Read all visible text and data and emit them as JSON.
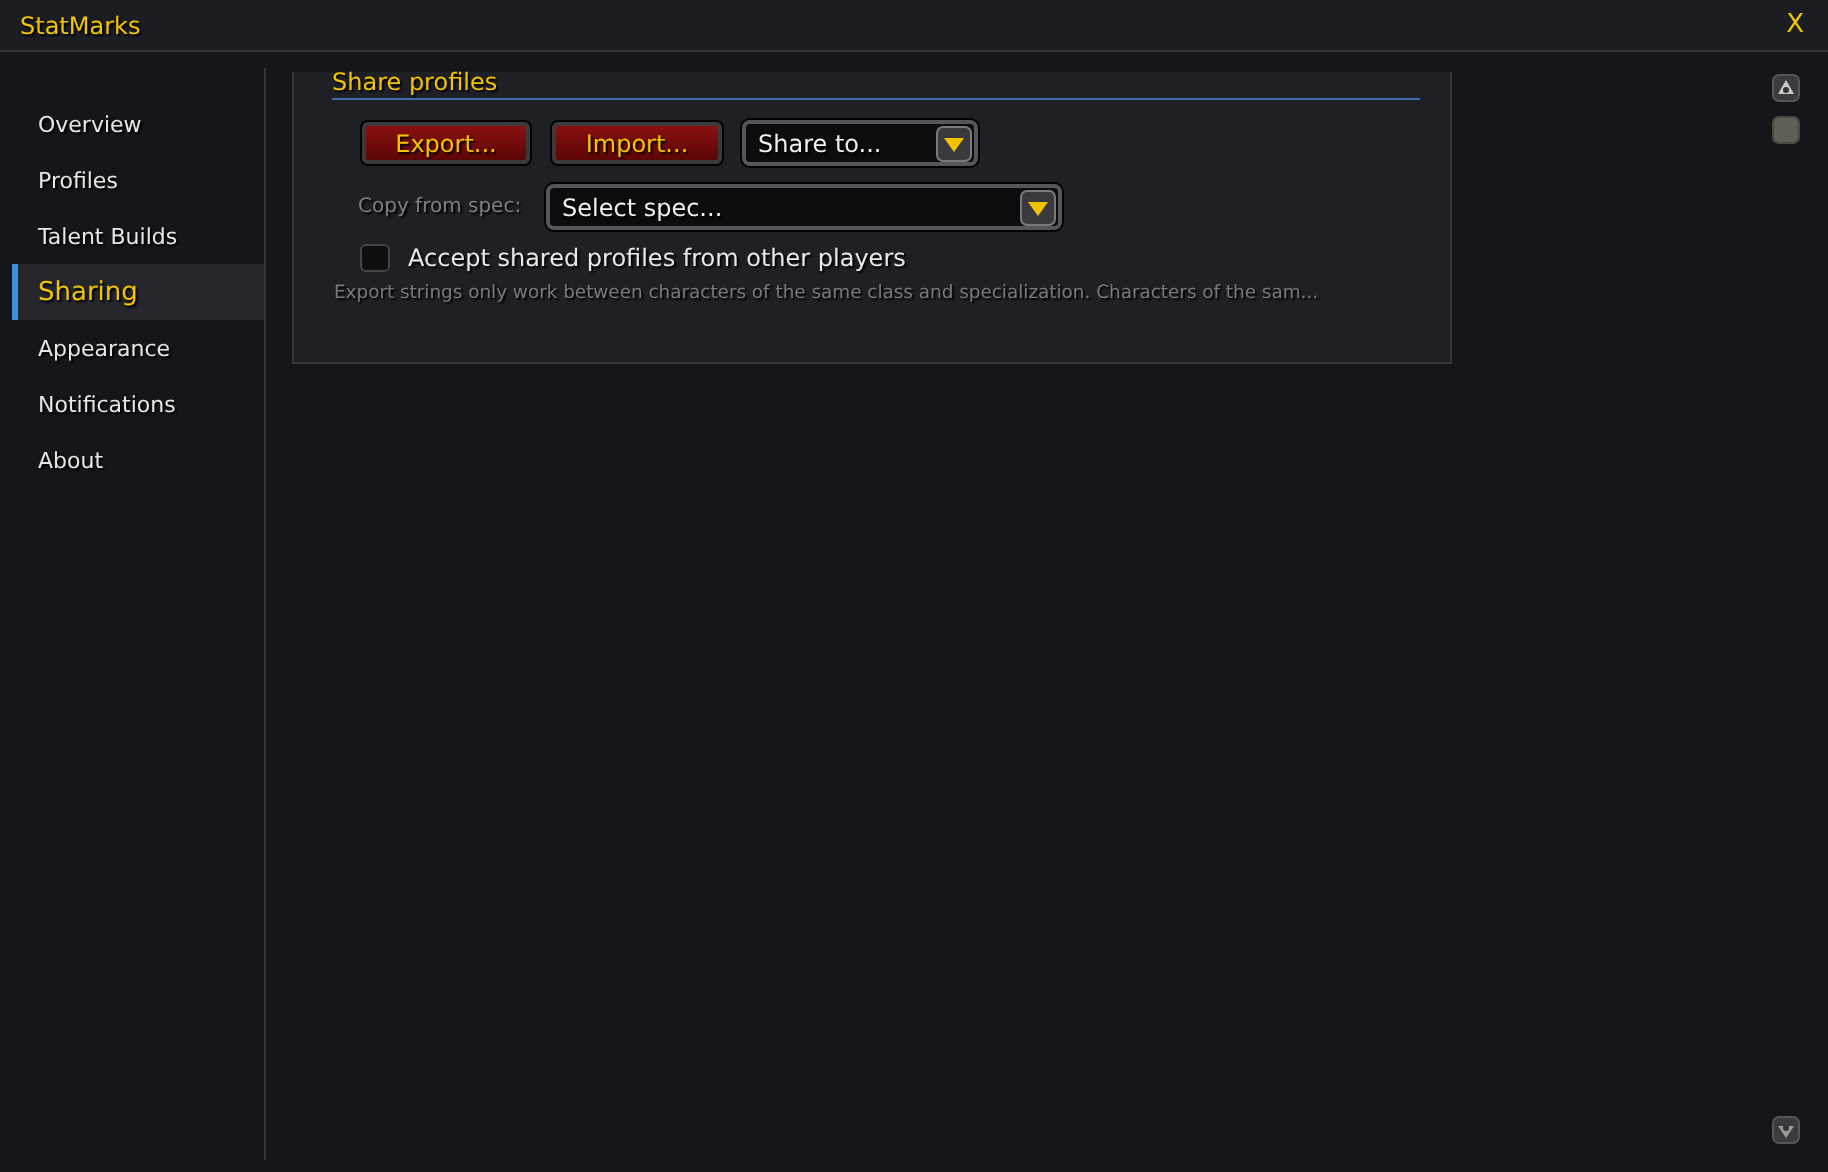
{
  "window": {
    "title": "StatMarks",
    "close": "X"
  },
  "sidebar": {
    "items": [
      {
        "label": "Overview",
        "selected": false
      },
      {
        "label": "Profiles",
        "selected": false
      },
      {
        "label": "Talent Builds",
        "selected": false
      },
      {
        "label": "Sharing",
        "selected": true
      },
      {
        "label": "Appearance",
        "selected": false
      },
      {
        "label": "Notifications",
        "selected": false
      },
      {
        "label": "About",
        "selected": false
      }
    ]
  },
  "section": {
    "title": "Share profiles",
    "buttons": [
      "Export...",
      "Import..."
    ],
    "share_dropdown": {
      "value": "Share to..."
    },
    "copy_from": {
      "label": "Copy from spec:",
      "value": "Select spec..."
    },
    "accept_checkbox": {
      "label": "Accept shared profiles from other players",
      "checked": false
    },
    "note": "Export strings only work between characters of the same class and specialization. Characters of the sam..."
  }
}
